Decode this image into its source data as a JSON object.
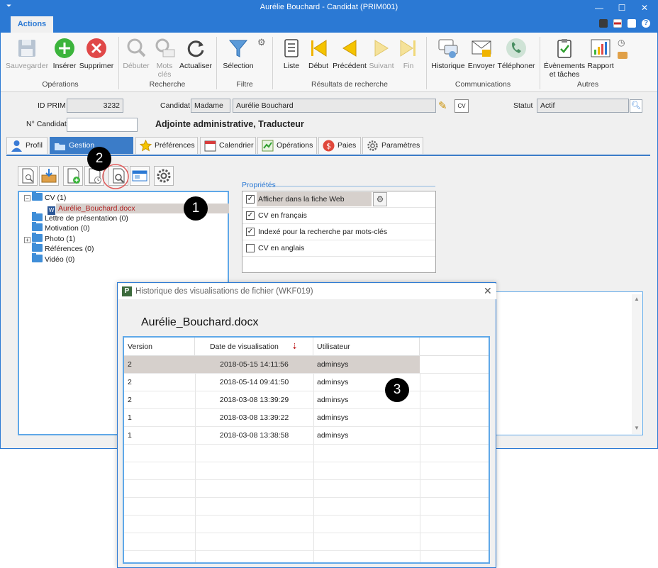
{
  "window": {
    "title": "Aurélie Bouchard - Candidat (PRIM001)"
  },
  "ribbon": {
    "tab": "Actions",
    "buttons": [
      {
        "label": "Sauvegarder",
        "icon": "floppy-disk-icon",
        "enabled": false
      },
      {
        "label": "Insérer",
        "icon": "plus-circle-icon",
        "enabled": true
      },
      {
        "label": "Supprimer",
        "icon": "delete-circle-icon",
        "enabled": true
      },
      {
        "label": "Débuter",
        "icon": "magnifier-icon",
        "enabled": false
      },
      {
        "label": "Mots clés",
        "icon": "keyword-search-icon",
        "enabled": false
      },
      {
        "label": "Actualiser",
        "icon": "refresh-icon",
        "enabled": true
      },
      {
        "label": "Sélection",
        "icon": "funnel-icon",
        "enabled": true
      },
      {
        "label": "Liste",
        "icon": "scroll-list-icon",
        "enabled": true
      },
      {
        "label": "Début",
        "icon": "first-icon",
        "enabled": true
      },
      {
        "label": "Précédent",
        "icon": "previous-icon",
        "enabled": true
      },
      {
        "label": "Suivant",
        "icon": "next-icon",
        "enabled": false
      },
      {
        "label": "Fin",
        "icon": "last-icon",
        "enabled": false
      },
      {
        "label": "Historique",
        "icon": "history-chat-icon",
        "enabled": true
      },
      {
        "label": "Envoyer",
        "icon": "envelope-icon",
        "enabled": true
      },
      {
        "label": "Téléphoner",
        "icon": "phone-icon",
        "enabled": true
      },
      {
        "label": "Évènements et tâches",
        "icon": "clipboard-check-icon",
        "enabled": true
      },
      {
        "label": "Rapport",
        "icon": "bar-report-icon",
        "enabled": true
      }
    ],
    "groups": [
      "Opérations",
      "Recherche",
      "Filtre",
      "Résultats de recherche",
      "Communications",
      "Autres"
    ]
  },
  "form": {
    "id_label": "ID PRIM",
    "id_value": "3232",
    "candidate_label": "Candidat",
    "title_value": "Madame",
    "name_value": "Aurélie Bouchard",
    "status_label": "Statut",
    "status_value": "Actif",
    "number_label": "N° Candidat",
    "number_value": "",
    "headline": "Adjointe administrative, Traducteur"
  },
  "tabs": [
    "Profil",
    "Gestion documents",
    "Préférences",
    "Calendrier",
    "Opérations",
    "Paies",
    "Paramètres"
  ],
  "tree": {
    "items": [
      {
        "label": "CV (1)"
      },
      {
        "label": "Aurélie_Bouchard.docx"
      },
      {
        "label": "Lettre de présentation (0)"
      },
      {
        "label": "Motivation (0)"
      },
      {
        "label": "Photo (1)"
      },
      {
        "label": "Références (0)"
      },
      {
        "label": "Vidéo (0)"
      }
    ]
  },
  "properties": {
    "legend": "Propriétés",
    "rows": [
      {
        "label": "Afficher dans la fiche Web",
        "checked": true
      },
      {
        "label": "CV en français",
        "checked": true
      },
      {
        "label": "Indexé pour la recherche par mots-clés",
        "checked": true
      },
      {
        "label": "CV en anglais",
        "checked": false
      }
    ]
  },
  "dialog": {
    "title": "Historique des visualisations de fichier (WKF019)",
    "file_name": "Aurélie_Bouchard.docx",
    "columns": [
      "Version",
      "Date de visualisation",
      "Utilisateur"
    ],
    "rows": [
      {
        "version": "2",
        "date": "2018-05-15 14:11:56",
        "user": "adminsys"
      },
      {
        "version": "2",
        "date": "2018-05-14 09:41:50",
        "user": "adminsys"
      },
      {
        "version": "2",
        "date": "2018-03-08 13:39:29",
        "user": "adminsys"
      },
      {
        "version": "1",
        "date": "2018-03-08 13:39:22",
        "user": "adminsys"
      },
      {
        "version": "1",
        "date": "2018-03-08 13:38:58",
        "user": "adminsys"
      }
    ]
  },
  "callouts": [
    "1",
    "2",
    "3"
  ],
  "colors": {
    "accent": "#2b79d4",
    "selected_row": "#d6d0cc",
    "tab_active": "#3b7cc8"
  }
}
